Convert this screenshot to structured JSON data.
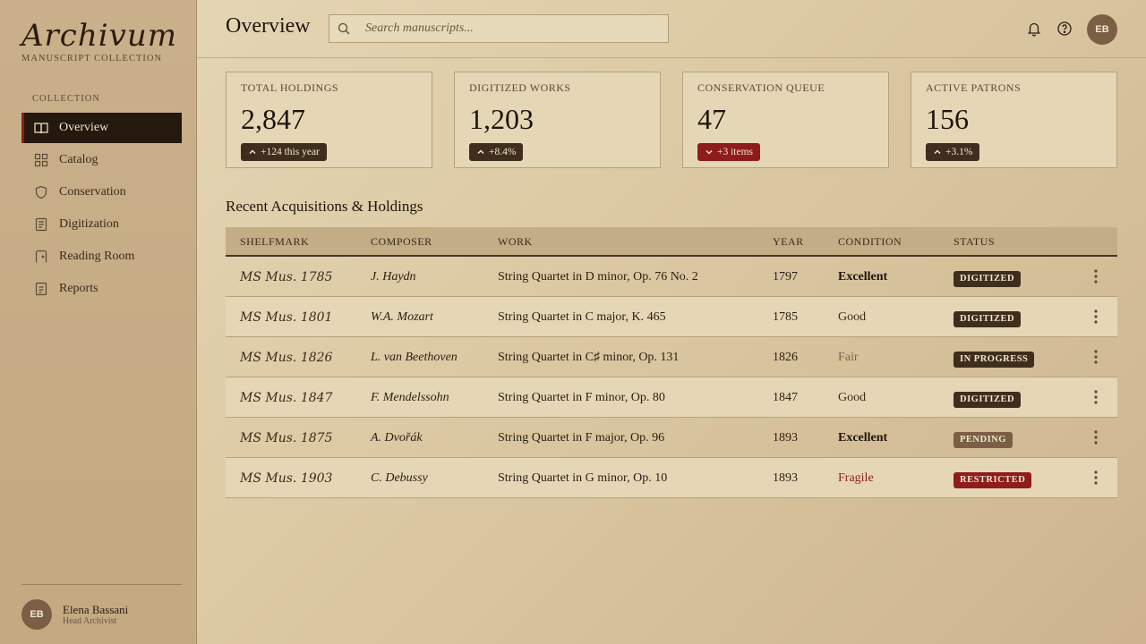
{
  "brand": {
    "name": "Archivum",
    "subtitle": "MANUSCRIPT COLLECTION"
  },
  "sidebar": {
    "section_label": "COLLECTION",
    "items": [
      {
        "label": "Overview",
        "icon": "open-book-icon",
        "active": true
      },
      {
        "label": "Catalog",
        "icon": "grid-icon",
        "active": false
      },
      {
        "label": "Conservation",
        "icon": "shield-icon",
        "active": false
      },
      {
        "label": "Digitization",
        "icon": "document-icon",
        "active": false
      },
      {
        "label": "Reading Room",
        "icon": "door-icon",
        "active": false
      },
      {
        "label": "Reports",
        "icon": "report-icon",
        "active": false
      }
    ],
    "user": {
      "initials": "EB",
      "name": "Elena Bassani",
      "role": "Head Archivist"
    }
  },
  "header": {
    "title": "Overview",
    "search_placeholder": "Search manuscripts...",
    "avatar_initials": "EB"
  },
  "stats": [
    {
      "label": "TOTAL HOLDINGS",
      "value": "2,847",
      "badge": "+124 this year",
      "trend": "up"
    },
    {
      "label": "DIGITIZED WORKS",
      "value": "1,203",
      "badge": "+8.4%",
      "trend": "up"
    },
    {
      "label": "CONSERVATION QUEUE",
      "value": "47",
      "badge": "+3 items",
      "trend": "down"
    },
    {
      "label": "ACTIVE PATRONS",
      "value": "156",
      "badge": "+3.1%",
      "trend": "up"
    }
  ],
  "table": {
    "title": "Recent Acquisitions & Holdings",
    "columns": [
      "SHELFMARK",
      "COMPOSER",
      "WORK",
      "YEAR",
      "CONDITION",
      "STATUS"
    ],
    "rows": [
      {
        "shelfmark": "MS Mus. 1785",
        "composer": "J. Haydn",
        "work": "String Quartet in D minor, Op. 76 No. 2",
        "year": "1797",
        "condition": "Excellent",
        "status": "DIGITIZED"
      },
      {
        "shelfmark": "MS Mus. 1801",
        "composer": "W.A. Mozart",
        "work": "String Quartet in C major, K. 465",
        "year": "1785",
        "condition": "Good",
        "status": "DIGITIZED"
      },
      {
        "shelfmark": "MS Mus. 1826",
        "composer": "L. van Beethoven",
        "work": "String Quartet in C♯ minor, Op. 131",
        "year": "1826",
        "condition": "Fair",
        "status": "IN PROGRESS"
      },
      {
        "shelfmark": "MS Mus. 1847",
        "composer": "F. Mendelssohn",
        "work": "String Quartet in F minor, Op. 80",
        "year": "1847",
        "condition": "Good",
        "status": "DIGITIZED"
      },
      {
        "shelfmark": "MS Mus. 1875",
        "composer": "A. Dvořák",
        "work": "String Quartet in F major, Op. 96",
        "year": "1893",
        "condition": "Excellent",
        "status": "PENDING"
      },
      {
        "shelfmark": "MS Mus. 1903",
        "composer": "C. Debussy",
        "work": "String Quartet in G minor, Op. 10",
        "year": "1893",
        "condition": "Fragile",
        "status": "RESTRICTED"
      }
    ]
  },
  "colors": {
    "accent_red": "#8e1c1c",
    "dark": "#24180f",
    "parchment": "#e5d7b6"
  }
}
